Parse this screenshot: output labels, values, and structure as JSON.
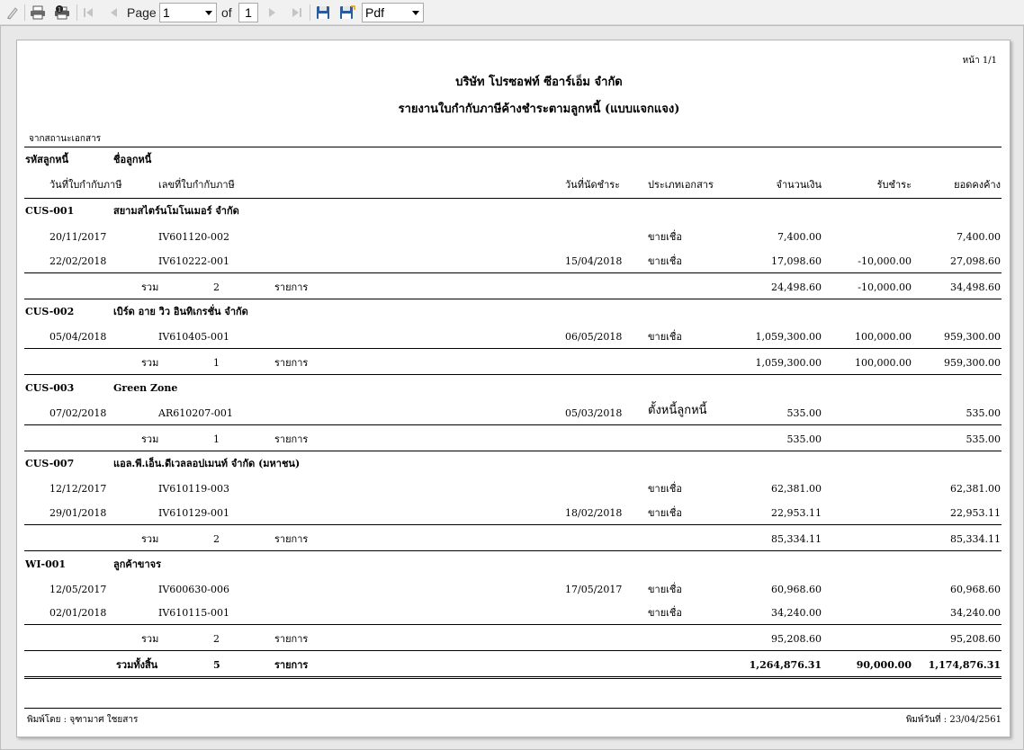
{
  "toolbar": {
    "page_label": "Page",
    "page_value": "1",
    "of_label": "of",
    "total_pages": "1",
    "export_format": "Pdf"
  },
  "report": {
    "page_info": "หน้า 1/1",
    "company": "บริษัท โปรซอฟท์ ซีอาร์เอ็ม จำกัด",
    "title": "รายงานใบกำกับภาษีค้างชำระตามลูกหนี้ (แบบแจกแจง)",
    "source": "จากสถานะเอกสาร",
    "headers": {
      "debtor_code": "รหัสลูกหนี้",
      "debtor_name": "ชื่อลูกหนี้",
      "invoice_date": "วันที่ใบกำกับภาษี",
      "invoice_no": "เลขที่ใบกำกับภาษี",
      "due_date": "วันที่นัดชำระ",
      "doc_type": "ประเภทเอกสาร",
      "amount": "จำนวนเงิน",
      "paid": "รับชำระ",
      "balance": "ยอดคงค้าง"
    },
    "groups": [
      {
        "code": "CUS-001",
        "name": "สยามสไตร์นโมโนเมอร์ จำกัด",
        "rows": [
          {
            "date": "20/11/2017",
            "invoice": "IV601120-002",
            "due": "",
            "type": "ขายเชื่อ",
            "amount": "7,400.00",
            "paid": "",
            "balance": "7,400.00"
          },
          {
            "date": "22/02/2018",
            "invoice": "IV610222-001",
            "due": "15/04/2018",
            "type": "ขายเชื่อ",
            "amount": "17,098.60",
            "paid": "-10,000.00",
            "balance": "27,098.60"
          }
        ],
        "total": {
          "label": "รวม",
          "count": "2",
          "unit": "รายการ",
          "amount": "24,498.60",
          "paid": "-10,000.00",
          "balance": "34,498.60"
        }
      },
      {
        "code": "CUS-002",
        "name": "เบิร์ด อาย วิว อินทิเกรชั่น จำกัด",
        "rows": [
          {
            "date": "05/04/2018",
            "invoice": "IV610405-001",
            "due": "06/05/2018",
            "type": "ขายเชื่อ",
            "amount": "1,059,300.00",
            "paid": "100,000.00",
            "balance": "959,300.00"
          }
        ],
        "total": {
          "label": "รวม",
          "count": "1",
          "unit": "รายการ",
          "amount": "1,059,300.00",
          "paid": "100,000.00",
          "balance": "959,300.00"
        }
      },
      {
        "code": "CUS-003",
        "name": "Green Zone",
        "rows": [
          {
            "date": "07/02/2018",
            "invoice": "AR610207-001",
            "due": "05/03/2018",
            "type": "ตั้งหนี้ลูกหนี้",
            "amount": "535.00",
            "paid": "",
            "balance": "535.00"
          }
        ],
        "total": {
          "label": "รวม",
          "count": "1",
          "unit": "รายการ",
          "amount": "535.00",
          "paid": "",
          "balance": "535.00"
        }
      },
      {
        "code": "CUS-007",
        "name": "แอล.พี.เอ็น.ดีเวลลอปเมนท์ จำกัด (มหาชน)",
        "rows": [
          {
            "date": "12/12/2017",
            "invoice": "IV610119-003",
            "due": "",
            "type": "ขายเชื่อ",
            "amount": "62,381.00",
            "paid": "",
            "balance": "62,381.00"
          },
          {
            "date": "29/01/2018",
            "invoice": "IV610129-001",
            "due": "18/02/2018",
            "type": "ขายเชื่อ",
            "amount": "22,953.11",
            "paid": "",
            "balance": "22,953.11"
          }
        ],
        "total": {
          "label": "รวม",
          "count": "2",
          "unit": "รายการ",
          "amount": "85,334.11",
          "paid": "",
          "balance": "85,334.11"
        }
      },
      {
        "code": "WI-001",
        "name": "ลูกค้าขาจร",
        "rows": [
          {
            "date": "12/05/2017",
            "invoice": "IV600630-006",
            "due": "17/05/2017",
            "type": "ขายเชื่อ",
            "amount": "60,968.60",
            "paid": "",
            "balance": "60,968.60"
          },
          {
            "date": "02/01/2018",
            "invoice": "IV610115-001",
            "due": "",
            "type": "ขายเชื่อ",
            "amount": "34,240.00",
            "paid": "",
            "balance": "34,240.00"
          }
        ],
        "total": {
          "label": "รวม",
          "count": "2",
          "unit": "รายการ",
          "amount": "95,208.60",
          "paid": "",
          "balance": "95,208.60"
        }
      }
    ],
    "grand_total": {
      "label": "รวมทั้งสิ้น",
      "count": "5",
      "unit": "รายการ",
      "amount": "1,264,876.31",
      "paid": "90,000.00",
      "balance": "1,174,876.31"
    },
    "printed_by": "พิมพ์โดย : จุฑามาศ ใชยสาร",
    "printed_date": "พิมพ์วันที่ : 23/04/2561"
  }
}
